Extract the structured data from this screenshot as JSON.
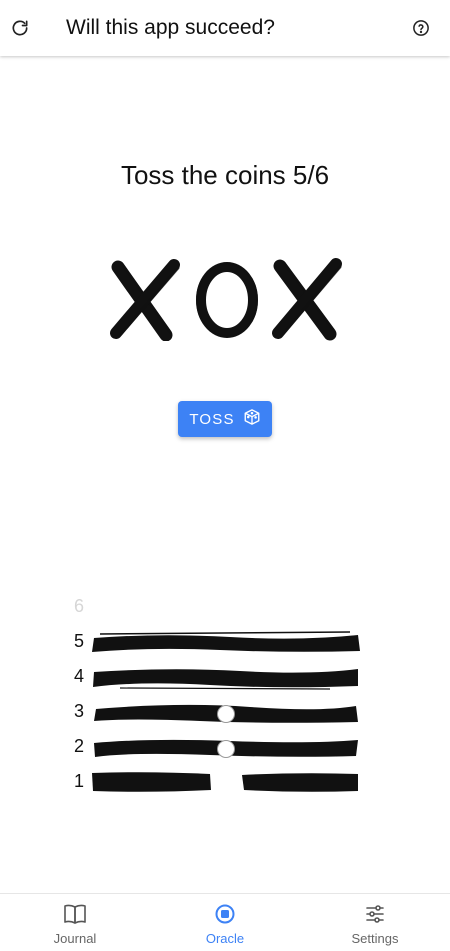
{
  "header": {
    "title": "Will this app succeed?",
    "refresh_icon": "refresh-icon",
    "help_icon": "help-circle-icon"
  },
  "oracle": {
    "heading": "Toss the coins 5/6",
    "coins": [
      "X",
      "O",
      "X"
    ],
    "toss_label": "TOSS",
    "toss_icon": "cube-icon",
    "accent": "#3d82f5"
  },
  "hexagram": {
    "lines": [
      {
        "number": "6",
        "cast": false,
        "type": null,
        "changing": false
      },
      {
        "number": "5",
        "cast": true,
        "type": "yang",
        "changing": false
      },
      {
        "number": "4",
        "cast": true,
        "type": "yang",
        "changing": false
      },
      {
        "number": "3",
        "cast": true,
        "type": "yang",
        "changing": true
      },
      {
        "number": "2",
        "cast": true,
        "type": "yang",
        "changing": true
      },
      {
        "number": "1",
        "cast": true,
        "type": "yin",
        "changing": false
      }
    ]
  },
  "nav": {
    "items": [
      {
        "label": "Journal",
        "icon": "book-icon",
        "active": false
      },
      {
        "label": "Oracle",
        "icon": "oracle-icon",
        "active": true
      },
      {
        "label": "Settings",
        "icon": "sliders-icon",
        "active": false
      }
    ]
  }
}
